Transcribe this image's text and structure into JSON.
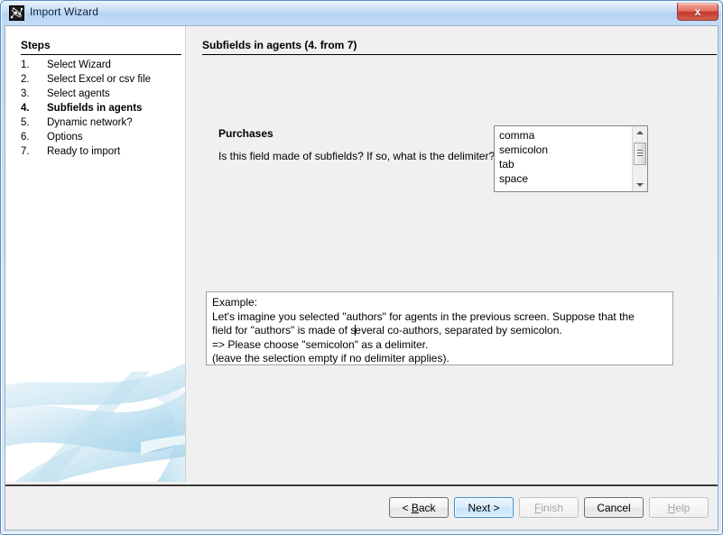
{
  "window": {
    "title": "Import Wizard",
    "icon": "network-graph-icon",
    "close_label": "x",
    "accent_blue": "#b6d3f4",
    "close_red": "#c4382a"
  },
  "sidebar": {
    "heading": "Steps",
    "steps": [
      {
        "num": "1.",
        "label": "Select Wizard",
        "current": false
      },
      {
        "num": "2.",
        "label": "Select Excel or csv file",
        "current": false
      },
      {
        "num": "3.",
        "label": "Select agents",
        "current": false
      },
      {
        "num": "4.",
        "label": "Subfields in agents",
        "current": true
      },
      {
        "num": "5.",
        "label": "Dynamic network?",
        "current": false
      },
      {
        "num": "6.",
        "label": "Options",
        "current": false
      },
      {
        "num": "7.",
        "label": "Ready to import",
        "current": false
      }
    ]
  },
  "main": {
    "title": "Subfields in agents (4. from 7)",
    "field_name": "Purchases",
    "question": "Is this field made of subfields? If so, what is the delimiter?",
    "delimiters": [
      "comma",
      "semicolon",
      "tab",
      "space"
    ],
    "example": {
      "line1": "Example:",
      "line2": "Let's imagine you selected \"authors\" for agents in the previous screen. Suppose that the",
      "line3a": "field for \"authors\" is made of s",
      "line3b": "everal co-authors, separated by semicolon.",
      "line4": "=> Please choose \"semicolon\" as a delimiter.",
      "line5": "(leave the selection empty if no delimiter applies)."
    }
  },
  "buttons": {
    "back": "< Back",
    "back_pre": "< ",
    "back_accel": "B",
    "back_post": "ack",
    "next": "Next >",
    "finish": "Finish",
    "finish_accel": "F",
    "finish_post": "inish",
    "cancel": "Cancel",
    "help": "Help",
    "help_accel": "H",
    "help_post": "elp"
  }
}
